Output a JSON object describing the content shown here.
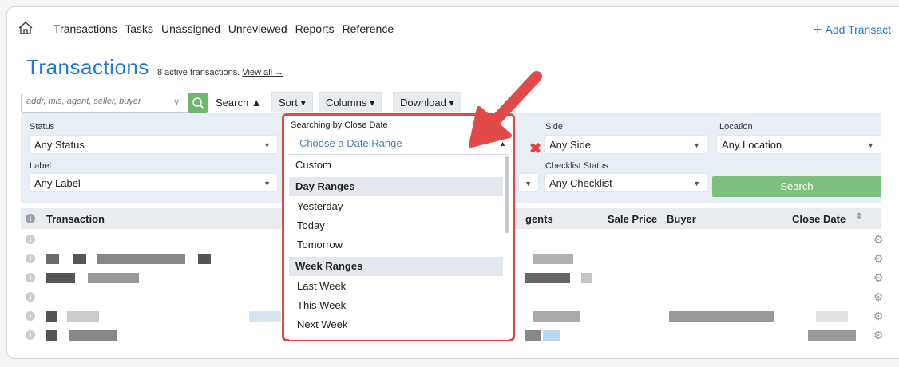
{
  "nav": {
    "links": [
      "Transactions",
      "Tasks",
      "Unassigned",
      "Unreviewed",
      "Reports",
      "Reference"
    ],
    "add_label": "Add Transact"
  },
  "page": {
    "title": "Transactions",
    "subtitle": "8 active transactions.",
    "view_all": "View all →"
  },
  "toolbar": {
    "search_placeholder": "addr, mls, agent, seller, buyer",
    "search_label": "Search ▲",
    "sort_label": "Sort ▾",
    "columns_label": "Columns ▾",
    "download_label": "Download ▾"
  },
  "filters": {
    "status_label": "Status",
    "status_value": "Any Status",
    "label_label": "Label",
    "label_value": "Any Label",
    "side_label": "Side",
    "side_value": "Any Side",
    "location_label": "Location",
    "location_value": "Any Location",
    "checklist_label": "Checklist Status",
    "checklist_value": "Any Checklist",
    "search_button": "Search"
  },
  "date_dropdown": {
    "label": "Searching by Close Date",
    "placeholder": "- Choose a Date Range -",
    "custom": "Custom",
    "group1": "Day Ranges",
    "day_options": [
      "Yesterday",
      "Today",
      "Tomorrow"
    ],
    "group2": "Week Ranges",
    "week_options": [
      "Last Week",
      "This Week",
      "Next Week"
    ]
  },
  "table": {
    "col_transaction": "Transaction",
    "col_agents": "gents",
    "col_sale_price": "Sale Price",
    "col_buyer": "Buyer",
    "col_close_date": "Close Date"
  },
  "colors": {
    "accent": "#1e78d4",
    "highlight_border": "#e04848",
    "filter_bg": "#e7eef6",
    "search_button": "#7dbf7c"
  }
}
